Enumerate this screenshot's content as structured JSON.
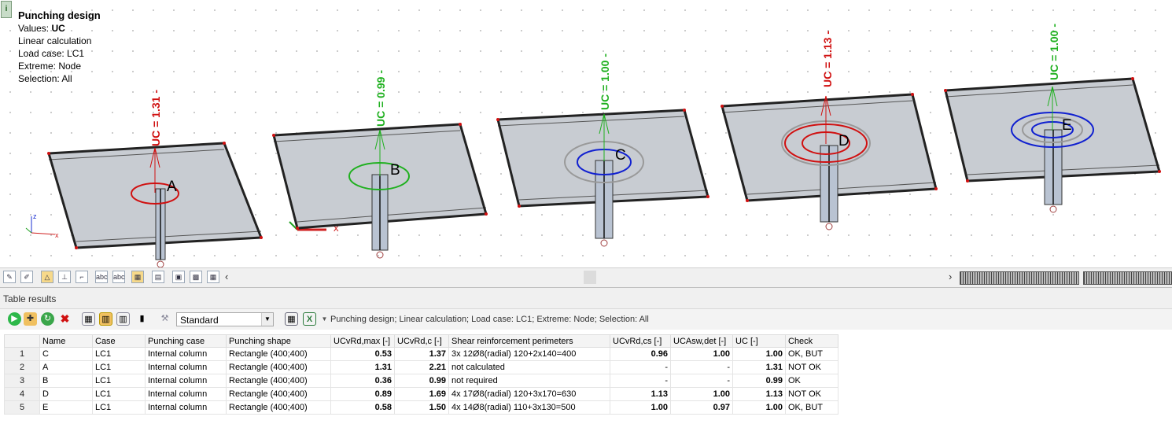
{
  "info": {
    "title": "Punching design",
    "values_label": "Values: ",
    "values_value": "UC",
    "calc": "Linear calculation",
    "load_case": "Load case: LC1",
    "extreme": "Extreme: Node",
    "selection": "Selection: All",
    "badge": "i"
  },
  "colors": {
    "ok": "#1fb01f",
    "notok": "#d01010",
    "blue": "#1020d0",
    "slab": "#c8ccd2"
  },
  "slabs": [
    {
      "node": "A",
      "uc_label": "UC = 1.31 -",
      "status": "notok"
    },
    {
      "node": "B",
      "uc_label": "UC = 0.99 -",
      "status": "ok"
    },
    {
      "node": "C",
      "uc_label": "UC = 1.00 -",
      "status": "ok"
    },
    {
      "node": "D",
      "uc_label": "UC = 1.13 -",
      "status": "notok"
    },
    {
      "node": "E",
      "uc_label": "UC = 1.00 -",
      "status": "ok"
    }
  ],
  "axes": {
    "x": "x",
    "z": "z"
  },
  "panel": {
    "title": "Table results",
    "style_value": "Standard",
    "status": "Punching design; Linear calculation; Load case: LC1; Extreme: Node; Selection: All"
  },
  "table": {
    "headers": [
      "Name",
      "Case",
      "Punching case",
      "Punching shape",
      "UCvRd,max [-]",
      "UCvRd,c [-]",
      "Shear reinforcement perimeters",
      "UCvRd,cs [-]",
      "UCAsw,det [-]",
      "UC [-]",
      "Check"
    ],
    "rows": [
      [
        "1",
        "C",
        "LC1",
        "Internal column",
        "Rectangle (400;400)",
        "0.53",
        "1.37",
        "3x 12Ø8(radial) 120+2x140=400",
        "0.96",
        "1.00",
        "1.00",
        "OK, BUT"
      ],
      [
        "2",
        "A",
        "LC1",
        "Internal column",
        "Rectangle (400;400)",
        "1.31",
        "2.21",
        "not calculated",
        "-",
        "-",
        "1.31",
        "NOT OK"
      ],
      [
        "3",
        "B",
        "LC1",
        "Internal column",
        "Rectangle (400;400)",
        "0.36",
        "0.99",
        "not required",
        "-",
        "-",
        "0.99",
        "OK"
      ],
      [
        "4",
        "D",
        "LC1",
        "Internal column",
        "Rectangle (400;400)",
        "0.89",
        "1.69",
        "4x 17Ø8(radial) 120+3x170=630",
        "1.13",
        "1.00",
        "1.13",
        "NOT OK"
      ],
      [
        "5",
        "E",
        "LC1",
        "Internal column",
        "Rectangle (400;400)",
        "0.58",
        "1.50",
        "4x 14Ø8(radial) 110+3x130=500",
        "1.00",
        "0.97",
        "1.00",
        "OK, BUT"
      ]
    ]
  }
}
